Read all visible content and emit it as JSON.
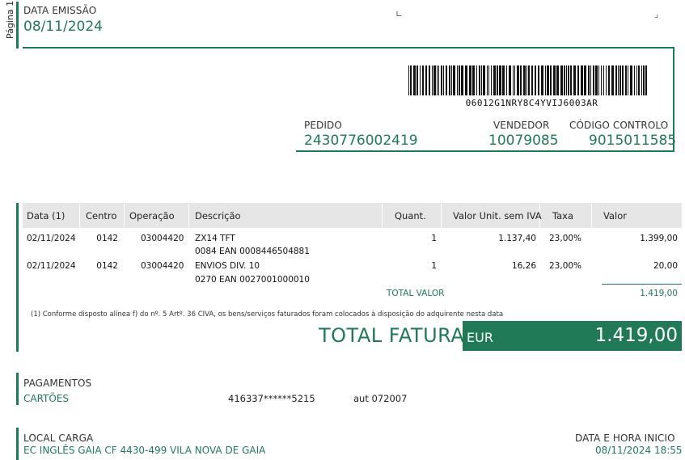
{
  "page_label": "Página 1",
  "header": {
    "date_label": "DATA EMISSÃO",
    "date_value": "08/11/2024",
    "corner_marks": [
      "∟",
      "⌟"
    ]
  },
  "barcode": {
    "text": "06012G1NRY8C4YVIJ6003AR"
  },
  "order": {
    "pedido_label": "PEDIDO",
    "pedido_value": "2430776002419",
    "vendedor_label": "VENDEDOR",
    "vendedor_value": "10079085",
    "codigo_label": "CÓDIGO CONTROLO",
    "codigo_value": "9015011585"
  },
  "table": {
    "headers": [
      "Data (1)",
      "Centro",
      "Operação",
      "Descrição",
      "Quant.",
      "Valor Unit. sem IVA",
      "Taxa",
      "Valor"
    ],
    "rows": [
      {
        "date": "02/11/2024",
        "center": "0142",
        "operation": "03004420",
        "description": "ZX14 TFT",
        "description_sub": "0084 EAN 0008446504881",
        "qty": "1",
        "unit_value": "1.137,40",
        "rate": "23,00%",
        "value": "1.399,00"
      },
      {
        "date": "02/11/2024",
        "center": "0142",
        "operation": "03004420",
        "description": "ENVIOS DIV. 10",
        "description_sub": "0270 EAN 0027001000010",
        "qty": "1",
        "unit_value": "16,26",
        "rate": "23,00%",
        "value": "20,00"
      }
    ],
    "total_label": "TOTAL VALOR",
    "total_value": "1.419,00"
  },
  "footnote": "(1) Conforme disposto alínea f) do nº. 5 Artº. 36 CIVA, os bens/serviços faturados foram colocados à disposição do adquirente nesta data",
  "invoice_total": {
    "label": "TOTAL FATURA",
    "currency": "EUR",
    "amount": "1.419,00"
  },
  "payments": {
    "title": "PAGAMENTOS",
    "method": "CARTÕES",
    "card": "416337******5215",
    "auth": "aut 072007"
  },
  "loading": {
    "place_label": "LOCAL CARGA",
    "place_value": "EC INGLÊS GAIA CF 4430-499 VILA NOVA DE GAIA",
    "datetime_label": "DATA E HORA INICIO",
    "datetime_value": "08/11/2024 18:55"
  },
  "colors": {
    "accent": "#1f7a55",
    "table_header": "#e6e6e6"
  }
}
